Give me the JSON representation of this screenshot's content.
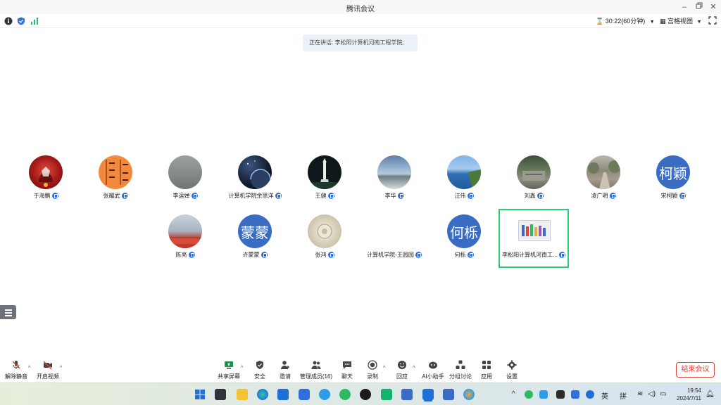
{
  "window": {
    "title": "腾讯会议"
  },
  "infobar": {
    "timer": "30:22(60分钟)",
    "view": "宫格视图"
  },
  "speaking": "正在讲话: 李松阳计算机河南工程学院;",
  "participants": [
    {
      "name": "于海鹏",
      "avatar": "photo-red",
      "color": "#c42a2a"
    },
    {
      "name": "张耀武",
      "avatar": "photo-calligraphy",
      "color": "#f08a3a"
    },
    {
      "name": "李运婵",
      "avatar": "photo-grey",
      "color": "#8f9695"
    },
    {
      "name": "计算机学院余思洋",
      "avatar": "photo-space",
      "color": "#1b2235"
    },
    {
      "name": "王健",
      "avatar": "photo-tower",
      "color": "#0f1a1c"
    },
    {
      "name": "李华",
      "avatar": "photo-sky",
      "color": "#6f8fb0"
    },
    {
      "name": "汪伟",
      "avatar": "photo-sea",
      "color": "#3b78b8"
    },
    {
      "name": "刘鑫",
      "avatar": "photo-stone",
      "color": "#4d5a43"
    },
    {
      "name": "凌广明",
      "avatar": "photo-road",
      "color": "#9a9186"
    },
    {
      "name": "宋柯颖",
      "avatar": "text",
      "text": "柯颖",
      "color": "#3a6cc4"
    },
    {
      "name": "陈亮",
      "avatar": "photo-flag",
      "color": "#b5413b"
    },
    {
      "name": "许蒙蒙",
      "avatar": "text",
      "text": "蒙蒙",
      "color": "#3a6cc4"
    },
    {
      "name": "张鸿",
      "avatar": "photo-flower",
      "color": "#d9d3c2"
    },
    {
      "name": "计算机学院-王园园",
      "avatar": "none",
      "color": "#ffffff"
    },
    {
      "name": "何栎",
      "avatar": "text",
      "text": "何栎",
      "color": "#3a6cc4"
    },
    {
      "name": "李松阳计算机河南工...",
      "avatar": "screen",
      "color": "#eef0f4",
      "active": true
    }
  ],
  "toolbar": {
    "unmute": "解除静音",
    "start_video": "开启视频",
    "share_screen": "共享屏幕",
    "security": "安全",
    "invite": "邀请",
    "members": "管理成员(16)",
    "chat": "聊天",
    "record": "录制",
    "react": "回应",
    "ai": "AI小助手",
    "breakout": "分组讨论",
    "apps": "应用",
    "settings": "设置",
    "end": "结束会议"
  },
  "taskbar": {
    "ime_lang": "英",
    "ime_mode": "拼",
    "time": "19:54",
    "date": "2024/7/11"
  }
}
